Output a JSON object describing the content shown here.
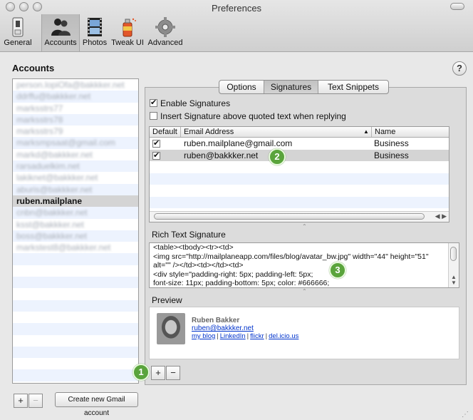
{
  "window": {
    "title": "Preferences"
  },
  "toolbar": {
    "items": [
      {
        "label": "General",
        "icon": "general-switch-icon"
      },
      {
        "label": "Accounts",
        "icon": "accounts-people-icon"
      },
      {
        "label": "Photos",
        "icon": "photos-film-icon"
      },
      {
        "label": "Tweak UI",
        "icon": "tweak-ui-spraycan-icon"
      },
      {
        "label": "Advanced",
        "icon": "advanced-gear-icon"
      }
    ],
    "active": "Accounts"
  },
  "accounts": {
    "heading": "Accounts",
    "items": [
      {
        "label": "person.lopiOfa@bakkker.net",
        "blurred": true
      },
      {
        "label": "ddrffu@bakkker.net",
        "blurred": true
      },
      {
        "label": "marksstrs77",
        "blurred": true
      },
      {
        "label": "marksstrs78",
        "blurred": true
      },
      {
        "label": "marksstrs79",
        "blurred": true
      },
      {
        "label": "marksmpsaat@gmail.com",
        "blurred": true
      },
      {
        "label": "markd@bakkker.net",
        "blurred": true
      },
      {
        "label": "rarsaduelkim.net",
        "blurred": true
      },
      {
        "label": "lakiknet@bakkker.net",
        "blurred": true
      },
      {
        "label": "aburis@bakkker.net",
        "blurred": true
      },
      {
        "label": "ruben.mailplane",
        "blurred": false,
        "selected": true
      },
      {
        "label": "cnbn@bakkker.net",
        "blurred": true
      },
      {
        "label": "ksst@bakkker.net",
        "blurred": true
      },
      {
        "label": "boss@bakkker.net",
        "blurred": true
      },
      {
        "label": "markstest8@bakkker.net",
        "blurred": true
      }
    ],
    "add_label": "+",
    "remove_label": "−",
    "create_gmail_label": "Create new Gmail account"
  },
  "help_label": "?",
  "tabs": [
    {
      "label": "Options",
      "active": false
    },
    {
      "label": "Signatures",
      "active": true
    },
    {
      "label": "Text Snippets",
      "active": false
    }
  ],
  "signatures": {
    "enable_label": "Enable Signatures",
    "enable_checked": true,
    "above_quoted_label": "Insert Signature above quoted text when replying",
    "above_quoted_checked": false,
    "columns": {
      "default": "Default",
      "email": "Email Address",
      "name": "Name"
    },
    "rows": [
      {
        "default": true,
        "email": "ruben.mailplane@gmail.com",
        "name": "Business"
      },
      {
        "default": true,
        "email": "ruben@bakkker.net",
        "name": "Business",
        "selected": true
      }
    ],
    "add_label": "+",
    "remove_label": "−"
  },
  "rich_text": {
    "label": "Rich Text Signature",
    "lines": [
      "<table><tbody><tr><td>",
      "<img src=\"http://mailplaneapp.com/files/blog/avatar_bw.jpg\" width=\"44\" height=\"51\"",
      "alt=\"\" /></td><td></td><td>",
      "<div style=\"padding-right: 5px; padding-left: 5px;",
      "font-size: 11px; padding-bottom: 5px; color: #666666;"
    ]
  },
  "preview": {
    "label": "Preview",
    "name": "Ruben Bakker",
    "email": "ruben@bakkker.net",
    "links": [
      "my blog",
      "LinkedIn",
      "flickr",
      "del.icio.us"
    ]
  },
  "badges": [
    "1",
    "2",
    "3"
  ],
  "colors": {
    "selection": "#d4d4d4",
    "row_alt": "#edf3fe",
    "badge": "#5aa43c",
    "link": "#0033cc"
  }
}
